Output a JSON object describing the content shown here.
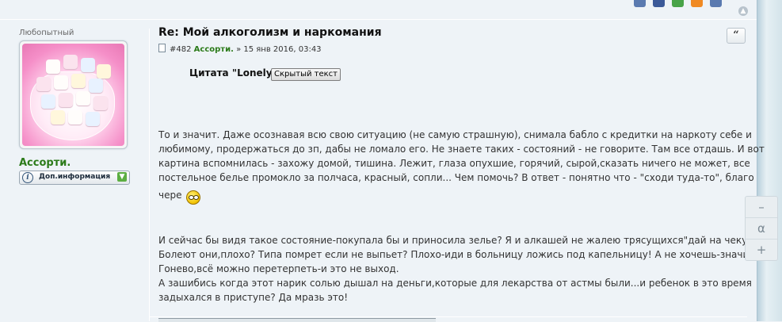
{
  "profile": {
    "rank": "Любопытный",
    "username": "Ассорти.",
    "info_button": "Доп.информация"
  },
  "post": {
    "title": "Re: Мой алкоголизм и наркомания",
    "number": "#482",
    "author": "Ассорти.",
    "separator": "»",
    "date": "15 янв 2016, 03:43",
    "quote_button": "“",
    "citation": "Цитата \"Lonely\"",
    "spoiler_button": "Скрытый текст",
    "paragraph1_lines": [
      "То и значит. Даже осознавая всю свою ситуацию (не самую страшную), снимала бабло с кредитки на наркоту себе и",
      "любимому, продержаться до зп, дабы не ломало его. Не знаете таких - состояний - не говорите. Там все отдашь. И вот",
      "картина вспомнилась - захожу домой, тишина. Лежит, глаза опухшие, горячий, сырой,сказать ничего не может, все",
      "постельное белье промокло за полчаса, красный, сопли... Чем помочь? В ответ - понятно что - \"сходи туда-то\", благо",
      "чере"
    ],
    "paragraph2_lines": [
      "И сейчас бы видя такое состояние-покупала бы и приносила зелье? Я и алкашей не жалею трясущихся\"дай на чекушку\"",
      "Болеют они,плохо? Типа помрет если не выпьет? Плохо-иди в больницу ложись под капельницу! А не хочешь-значит-",
      "Гонево,всё можно перетерпеть-и это не выход.",
      "А зашибись когда этот нарик солью дышал на деньги,которые для лекарства от астмы были...и ребенок в это время",
      "задыхался в приступе? Да мразь это!"
    ]
  },
  "side_widget": {
    "minus": "–",
    "alpha": "α",
    "plus": "+"
  },
  "colors": {
    "username": "#2c7b1a",
    "background": "#eef3f7"
  },
  "icons": [
    "top-arrow-icon",
    "document-icon",
    "info-icon",
    "download-arrow-icon",
    "smiley-icon"
  ]
}
